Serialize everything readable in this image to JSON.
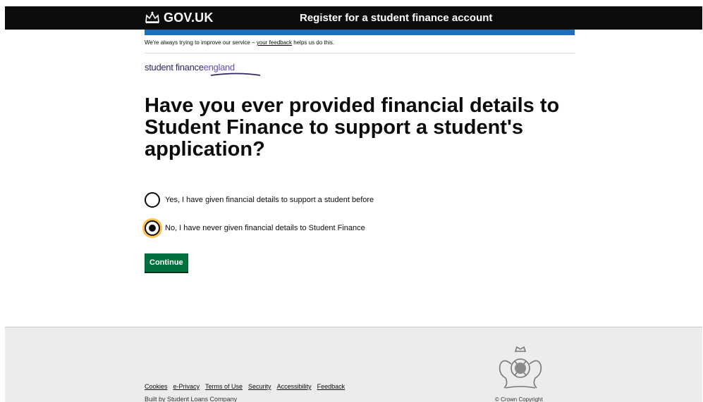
{
  "header": {
    "logo_text": "GOV.UK",
    "service_name": "Register for a student finance account"
  },
  "banner": {
    "text_before": "We're always trying to improve our service – ",
    "feedback_link": "your feedback",
    "text_after": " helps us do this."
  },
  "brand": {
    "student_finance": "student finance",
    "england": "england"
  },
  "question": {
    "heading": "Have you ever provided financial details to Student Finance to support a student's application?"
  },
  "options": [
    {
      "label": "Yes, I have given financial details to support a student before",
      "checked": false
    },
    {
      "label": "No, I have never given financial details to Student Finance",
      "checked": true
    }
  ],
  "continue_label": "Continue",
  "footer": {
    "links": [
      "Cookies",
      "e-Privacy",
      "Terms of Use",
      "Security",
      "Accessibility",
      "Feedback"
    ],
    "built_by": "Built by Student Loans Company",
    "copyright": "© Crown Copyright"
  },
  "colors": {
    "header_bg": "#0b0c0c",
    "blue_bar": "#1d70b8",
    "button_green": "#00703c",
    "focus_yellow": "#ffbf47",
    "footer_bg": "#ececec"
  },
  "icons": {
    "crown": "crown-icon",
    "crest": "royal-coat-of-arms-icon"
  }
}
